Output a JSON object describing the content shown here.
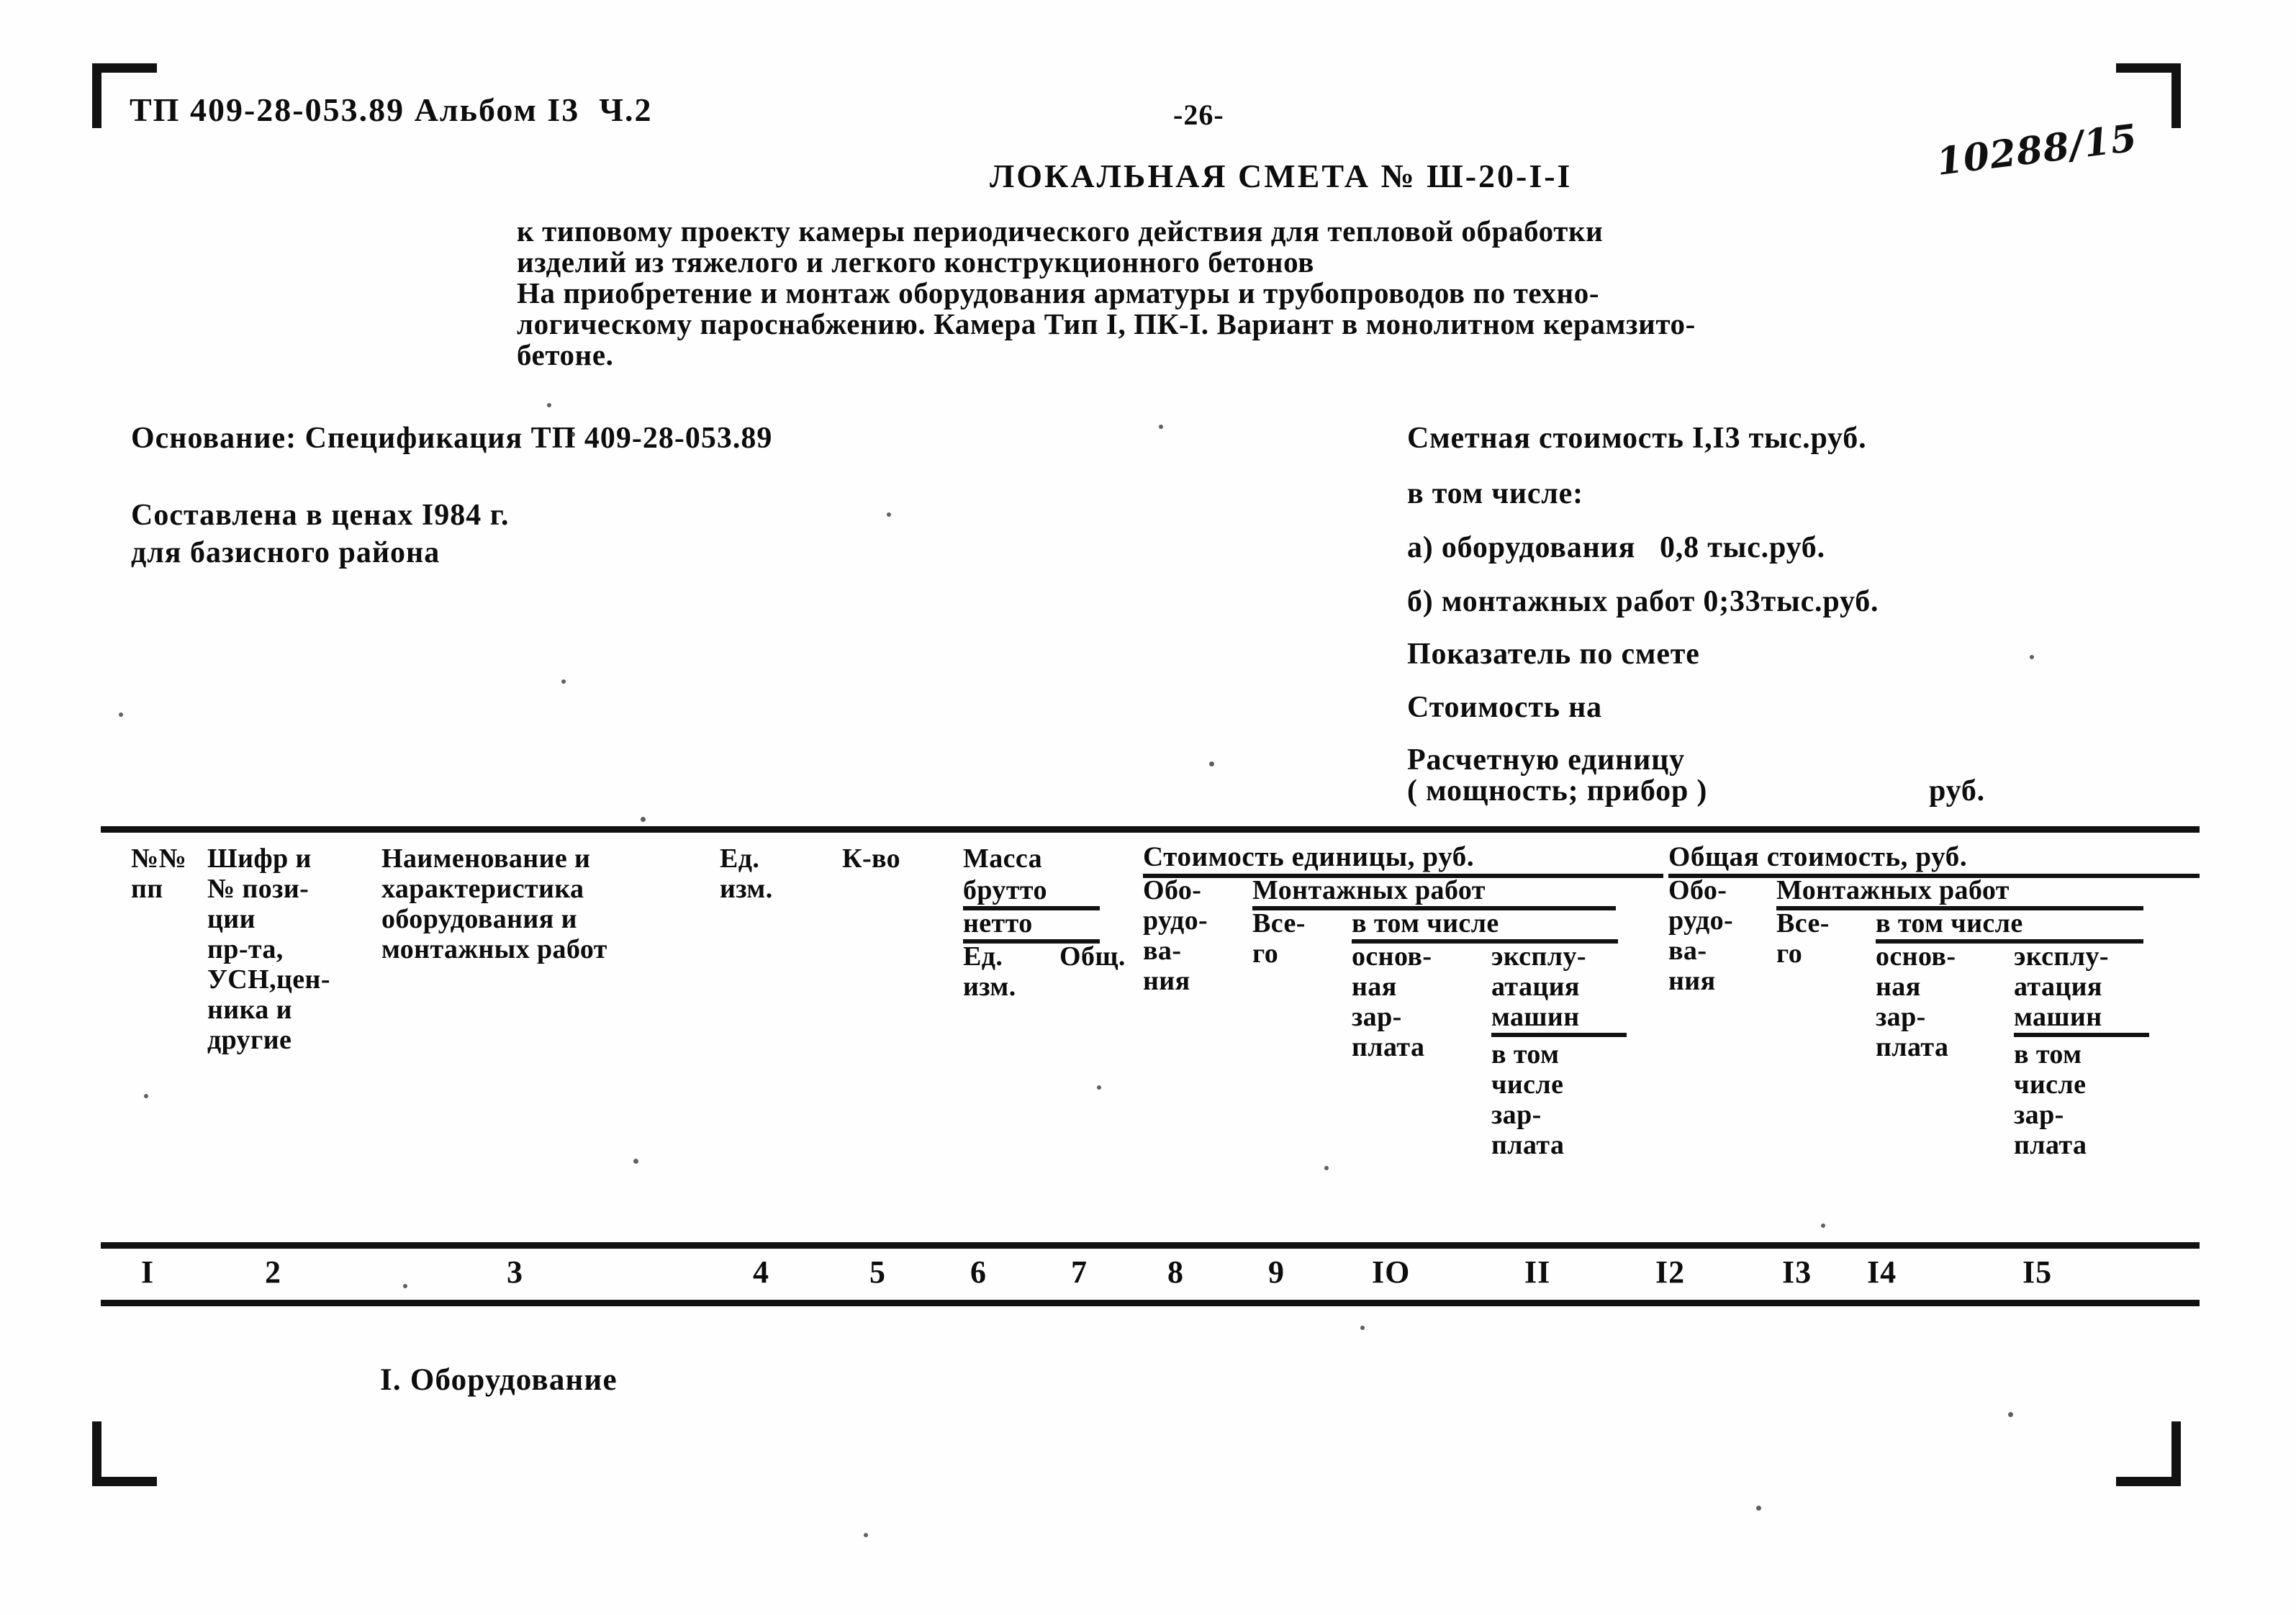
{
  "document": {
    "header_code": "ТП 409-28-053.89 Альбом I3  Ч.2",
    "page_number": "-26-",
    "handwritten_note": "10288/15",
    "title": "ЛОКАЛЬНАЯ СМЕТА № Ш-20-I-I",
    "description": "к типовому проекту камеры периодического действия для тепловой обработки\nизделий из тяжелого и легкого конструкционного бетонов\nНа приобретение и монтаж оборудования арматуры и трубопроводов по техно-\nлогическому пароснабжению. Камера Тип I, ПК-I. Вариант в монолитном керамзито-\nбетоне."
  },
  "left_block": {
    "osnovanie": "Основание: Спецификация ТП 409-28-053.89",
    "sostavlena": "Составлена в ценах I984 г.\nдля базисного района"
  },
  "summary": {
    "total_label": "Сметная стоимость I,I3 тыс.руб.",
    "including_label": "в том числе:",
    "item_a": "а) оборудования   0,8 тыс.руб.",
    "item_b": "б) монтажных работ 0;33тыс.руб.",
    "indicator_label": "Показатель по смете",
    "cost_on_label": "Стоимость на",
    "unit_label": "Расчетную единицу",
    "power_label": "( мощность; прибор )",
    "currency_label": "руб."
  },
  "table": {
    "headers": {
      "col1": "№№\nпп",
      "col2": "Шифр и\n№ пози-\nции\nпр-та,\nУСН,цен-\nника и\nдругие",
      "col3": "Наименование и\nхарактеристика\nоборудования и\nмонтажных работ",
      "col4": "Ед.\nизм.",
      "col5": "К-во",
      "col6_title": "Масса",
      "col6_brutto": "брутто",
      "col6_netto": "нетто",
      "col6_ed": "Ед.\nизм.",
      "col7_obsh": "Общ.",
      "group_left": "Стоимость единицы, руб.",
      "group_right": "Общая стоимость, руб.",
      "col8": "Обо-\nрудо-\nва-\nния",
      "col9_group": "Монтажных работ",
      "col9": "Все-\nго",
      "col10_11_group": "в том числе",
      "col10": "основ-\nная\nзар-\nплата",
      "col11_a": "эксплу-\nатация\nмашин",
      "col11_b": "в том\nчисле\nзар-\nплата",
      "col12": "Обо-\nрудо-\nва-\nния",
      "col13_group": "Монтажных работ",
      "col13": "Все-\nго",
      "col14_15_group": "в том числе",
      "col14": "основ-\nная\nзар-\nплата",
      "col15_a": "эксплу-\nатация\nмашин",
      "col15_b": "в том\nчисле\nзар-\nплата"
    },
    "column_numbers": [
      "I",
      "2",
      "3",
      "4",
      "5",
      "6",
      "7",
      "8",
      "9",
      "IO",
      "II",
      "I2",
      "I3",
      "I4",
      "I5"
    ],
    "section_label": "I. Оборудование"
  }
}
